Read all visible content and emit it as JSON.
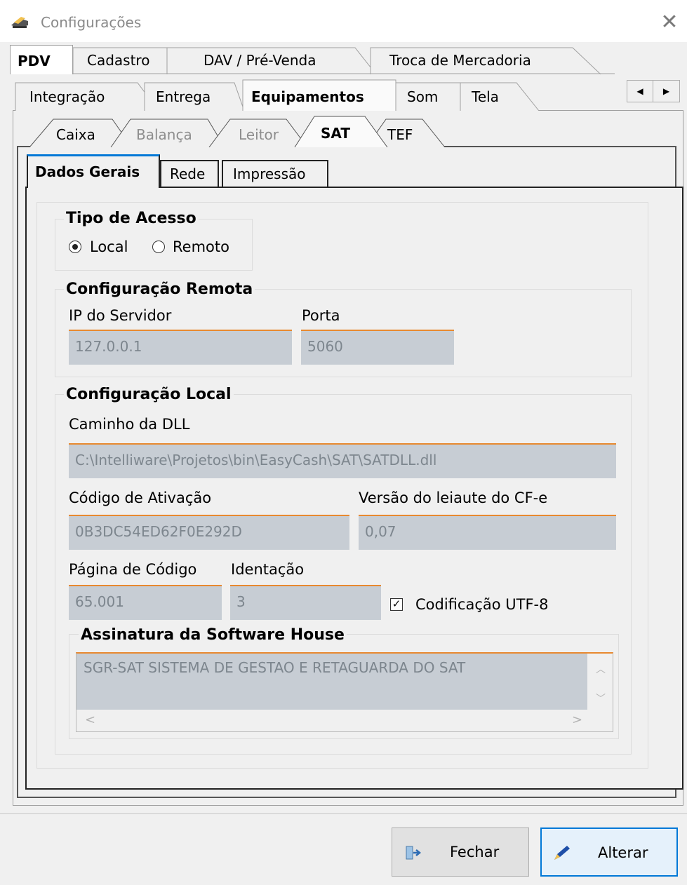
{
  "window": {
    "title": "Configurações",
    "close_glyph": "✕"
  },
  "tabs_level1": [
    "PDV",
    "Cadastro",
    "DAV / Pré-Venda",
    "Troca de Mercadoria"
  ],
  "tabs_level2": [
    "Integração",
    "Entrega",
    "Equipamentos",
    "Som",
    "Tela"
  ],
  "tabs_level3": [
    "Caixa",
    "Balança",
    "Leitor",
    "SAT",
    "TEF"
  ],
  "tabs_level4": [
    "Dados Gerais",
    "Rede",
    "Impressão"
  ],
  "scroll_arrows": {
    "left": "◀",
    "right": "▶"
  },
  "tipo_acesso": {
    "title": "Tipo de Acesso",
    "options": [
      "Local",
      "Remoto"
    ],
    "selected": "Local"
  },
  "config_remota": {
    "title": "Configuração Remota",
    "ip_label": "IP do Servidor",
    "ip_value": "127.0.0.1",
    "porta_label": "Porta",
    "porta_value": "5060"
  },
  "config_local": {
    "title": "Configuração Local",
    "dll_label": "Caminho da DLL",
    "dll_value": "C:\\Intelliware\\Projetos\\bin\\EasyCash\\SAT\\SATDLL.dll",
    "ativacao_label": "Código de Ativação",
    "ativacao_value": "0B3DC54ED62F0E292D",
    "versao_label": "Versão do leiaute do CF-e",
    "versao_value": "0,07",
    "pagina_label": "Página de Código",
    "pagina_value": "65.001",
    "identacao_label": "Identação",
    "identacao_value": "3",
    "utf8_label": "Codificação UTF-8",
    "utf8_checked": true
  },
  "assinatura": {
    "title": "Assinatura da Software House",
    "value": "SGR-SAT SISTEMA DE GESTAO E RETAGUARDA DO SAT"
  },
  "buttons": {
    "fechar": "Fechar",
    "alterar": "Alterar"
  },
  "colors": {
    "accent": "#e8892f",
    "field_bg": "#c7cdd4",
    "primary_border": "#0078d7"
  }
}
